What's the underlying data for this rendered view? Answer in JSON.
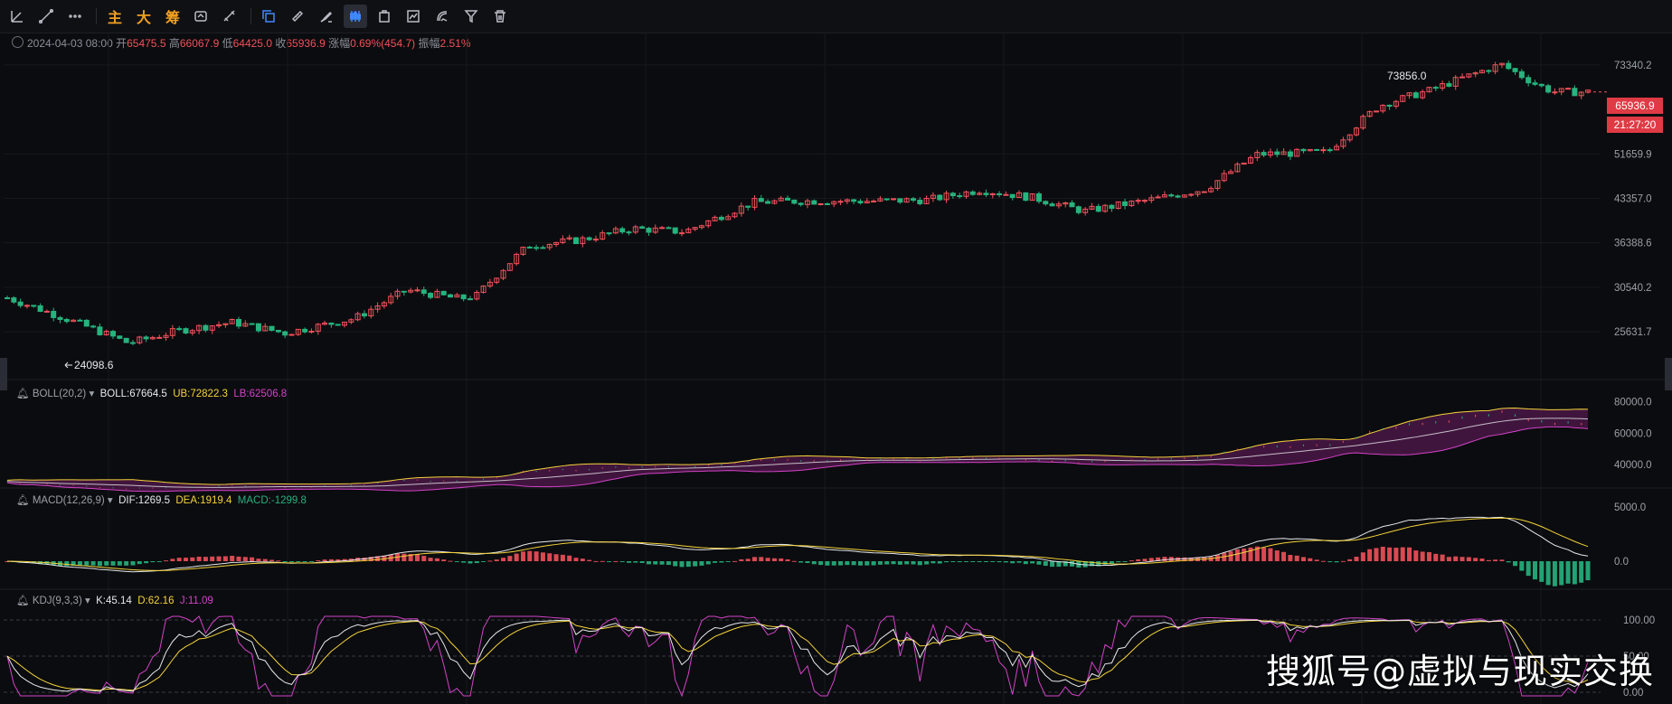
{
  "toolbar": {
    "labels": [
      "主",
      "大",
      "筹"
    ],
    "icons": [
      "trendline-icon",
      "line-icon",
      "more-icon",
      "compare-icon",
      "measure-icon",
      "brush-icon",
      "candlestick-icon",
      "clipboard-icon",
      "indicator-icon",
      "template-icon",
      "filter-icon",
      "trash-icon"
    ]
  },
  "ohlc": {
    "date": "2024-04-03 08:00",
    "open_label": "开",
    "open": "65475.5",
    "high_label": "高",
    "high": "66067.9",
    "low_label": "低",
    "low": "64425.0",
    "close_label": "收",
    "close": "65936.9",
    "change_label": "涨幅",
    "change": "0.69%(454.7)",
    "amp_label": "振幅",
    "amp": "2.51%"
  },
  "price_tags": {
    "last": "65936.9",
    "countdown": "21:27:20"
  },
  "annotations": {
    "high": "73856.0",
    "low": "24098.6"
  },
  "boll": {
    "name": "BOLL(20,2)",
    "mid_label": "BOLL:",
    "mid": "67664.5",
    "ub_label": "UB:",
    "ub": "72822.3",
    "lb_label": "LB:",
    "lb": "62506.8"
  },
  "macd": {
    "name": "MACD(12,26,9)",
    "dif_label": "DIF:",
    "dif": "1269.5",
    "dea_label": "DEA:",
    "dea": "1919.4",
    "macd_label": "MACD:",
    "macd": "-1299.8"
  },
  "kdj": {
    "name": "KDJ(9,3,3)",
    "k_label": "K:",
    "k": "45.14",
    "d_label": "D:",
    "d": "62.16",
    "j_label": "J:",
    "j": "11.09"
  },
  "watermark": "搜狐号@虚拟与现实交换",
  "colors": {
    "up": "#f0515b",
    "down": "#26b37e",
    "boll_mid": "#e6e8eb",
    "boll_ub": "#f5d33a",
    "boll_lb": "#d243c8",
    "band_fill": "#4a1745",
    "dea": "#f5d33a",
    "dif": "#e6e8eb",
    "j": "#d243c8"
  },
  "chart_data": [
    {
      "type": "candlestick",
      "title": "",
      "y_ticks": [
        73340.2,
        51659.9,
        43357.0,
        36388.6,
        30540.2,
        25631.7
      ],
      "ylim": [
        22000,
        76500
      ],
      "points": [
        [
          0,
          29300,
          32
        ],
        [
          7,
          24500,
          24
        ],
        [
          10,
          25800,
          21
        ],
        [
          13,
          26600,
          24
        ],
        [
          16,
          25500,
          20
        ],
        [
          20,
          27000,
          24
        ],
        [
          23,
          30200,
          22
        ],
        [
          26,
          29200,
          26
        ],
        [
          27,
          29500,
          26
        ],
        [
          30,
          36000,
          21
        ],
        [
          33,
          36800,
          22
        ],
        [
          36,
          38500,
          24
        ],
        [
          39,
          38000,
          22
        ],
        [
          43,
          42700,
          26
        ],
        [
          46,
          42900,
          24
        ],
        [
          50,
          42900,
          24
        ],
        [
          53,
          43100,
          25
        ],
        [
          56,
          44800,
          24
        ],
        [
          59,
          43500,
          24
        ],
        [
          62,
          41200,
          24
        ],
        [
          66,
          43200,
          24
        ],
        [
          69,
          45000,
          16
        ],
        [
          72,
          51600,
          29
        ],
        [
          76,
          52000,
          27
        ],
        [
          79,
          62500,
          31
        ],
        [
          82,
          66500,
          22
        ],
        [
          84,
          70000,
          23
        ],
        [
          86,
          73500,
          21
        ],
        [
          88,
          68000,
          17
        ],
        [
          89,
          66000,
          16
        ],
        [
          91,
          65900,
          16
        ]
      ]
    },
    {
      "type": "line",
      "title": "BOLL(20,2)",
      "y_ticks": [
        80000.0,
        60000.0,
        40000.0
      ],
      "series": [
        "BOLL",
        "UB",
        "LB"
      ]
    },
    {
      "type": "bar",
      "title": "MACD(12,26,9)",
      "y_ticks": [
        5000.0,
        0.0
      ],
      "series": [
        "DIF",
        "DEA",
        "MACD"
      ]
    },
    {
      "type": "line",
      "title": "KDJ(9,3,3)",
      "y_ticks": [
        100.0,
        50.0,
        0.0
      ],
      "series": [
        "K",
        "D",
        "J"
      ]
    }
  ]
}
